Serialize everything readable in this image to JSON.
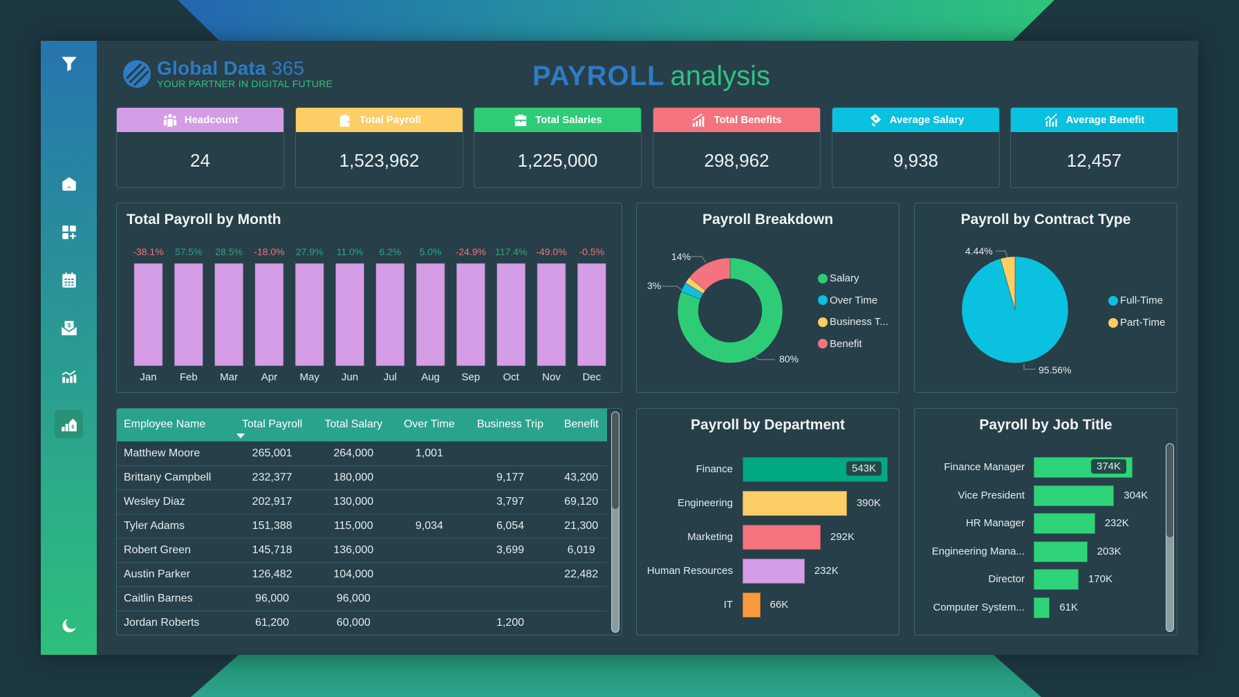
{
  "brand": {
    "name_bold": "Global Data",
    "name_light": "365",
    "tagline": "YOUR PARTNER IN DIGITAL FUTURE"
  },
  "page_title": {
    "part1": "PAYROLL",
    "part2": "analysis"
  },
  "sidebar": {
    "items": [
      {
        "name": "filter",
        "icon": "filter-icon"
      },
      {
        "name": "home",
        "icon": "home-icon"
      },
      {
        "name": "dashboard",
        "icon": "add-widget-icon"
      },
      {
        "name": "calendar",
        "icon": "calendar-icon"
      },
      {
        "name": "payslip",
        "icon": "money-envelope-icon"
      },
      {
        "name": "analytics",
        "icon": "bar-line-chart-icon"
      },
      {
        "name": "payroll",
        "icon": "dollar-growth-icon",
        "active": true
      },
      {
        "name": "theme",
        "icon": "moon-icon"
      }
    ]
  },
  "kpis": [
    {
      "label": "Headcount",
      "value": "24",
      "color": "#d59de6",
      "icon": "people-icon"
    },
    {
      "label": "Total Payroll",
      "value": "1,523,962",
      "color": "#fdcd66",
      "icon": "wallet-icon"
    },
    {
      "label": "Total Salaries",
      "value": "1,225,000",
      "color": "#2fcc78",
      "icon": "briefcase-icon"
    },
    {
      "label": "Total Benefits",
      "value": "298,962",
      "color": "#f4737e",
      "icon": "growth-chart-icon"
    },
    {
      "label": "Average Salary",
      "value": "9,938",
      "color": "#0bc1e0",
      "icon": "money-bill-icon"
    },
    {
      "label": "Average Benefit",
      "value": "12,457",
      "color": "#0bc1e0",
      "icon": "trend-chart-icon"
    }
  ],
  "chart_data": [
    {
      "id": "monthly",
      "type": "bar",
      "title": "Total Payroll by Month",
      "categories": [
        "Jan",
        "Feb",
        "Mar",
        "Apr",
        "May",
        "Jun",
        "Jul",
        "Aug",
        "Sep",
        "Oct",
        "Nov",
        "Dec"
      ],
      "values": [
        100,
        100,
        100,
        100,
        100,
        100,
        100,
        100,
        100,
        100,
        100,
        100
      ],
      "value_note": "bars shown at equal (100%) height",
      "labels": [
        "-38.1%",
        "57.5%",
        "28.5%",
        "-18.0%",
        "27.9%",
        "11.0%",
        "6.2%",
        "5.0%",
        "-24.9%",
        "117.4%",
        "-49.0%",
        "-0.5%"
      ],
      "bar_color": "#d59de6",
      "positive_color": "#2fa57e",
      "negative_color": "#f4737e",
      "xlabel": "",
      "ylabel": ""
    },
    {
      "id": "breakdown",
      "type": "pie",
      "donut": true,
      "title": "Payroll Breakdown",
      "categories": [
        "Salary",
        "Over Time",
        "Business T...",
        "Benefit"
      ],
      "values": [
        80,
        3,
        2,
        14
      ],
      "labels": [
        "80%",
        "3%",
        "",
        "14%"
      ],
      "colors": [
        "#2fcc78",
        "#0bc1e0",
        "#fdcd66",
        "#f4737e"
      ],
      "legend": "right"
    },
    {
      "id": "contract",
      "type": "pie",
      "title": "Payroll by Contract Type",
      "categories": [
        "Full-Time",
        "Part-Time"
      ],
      "values": [
        95.56,
        4.44
      ],
      "labels": [
        "95.56%",
        "4.44%"
      ],
      "colors": [
        "#0bc1e0",
        "#fdcd66"
      ],
      "legend": "right"
    },
    {
      "id": "department",
      "type": "bar",
      "orientation": "horizontal",
      "title": "Payroll by Department",
      "categories": [
        "Finance",
        "Engineering",
        "Marketing",
        "Human Resources",
        "IT"
      ],
      "values": [
        543,
        390,
        292,
        232,
        66
      ],
      "labels": [
        "543K",
        "390K",
        "292K",
        "232K",
        "66K"
      ],
      "colors": [
        "#01a882",
        "#fdcd66",
        "#f4737e",
        "#d59de6",
        "#fd9a3d"
      ],
      "unit": "K"
    },
    {
      "id": "jobtitle",
      "type": "bar",
      "orientation": "horizontal",
      "title": "Payroll by Job Title",
      "categories": [
        "Finance Manager",
        "Vice President",
        "HR Manager",
        "Engineering Mana...",
        "Director",
        "Computer System..."
      ],
      "values": [
        374,
        304,
        232,
        203,
        170,
        61
      ],
      "labels": [
        "374K",
        "304K",
        "232K",
        "203K",
        "170K",
        "61K"
      ],
      "colors": [
        "#2fd37a",
        "#2fd37a",
        "#2fd37a",
        "#2fd37a",
        "#2fd37a",
        "#2fd37a"
      ],
      "unit": "K"
    }
  ],
  "table": {
    "columns": [
      "Employee Name",
      "Total Payroll",
      "Total Salary",
      "Over Time",
      "Business Trip",
      "Benefit"
    ],
    "sorted_column": "Total Payroll",
    "rows": [
      [
        "Matthew Moore",
        "265,001",
        "264,000",
        "1,001",
        "",
        ""
      ],
      [
        "Brittany Campbell",
        "232,377",
        "180,000",
        "",
        "9,177",
        "43,200"
      ],
      [
        "Wesley Diaz",
        "202,917",
        "130,000",
        "",
        "3,797",
        "69,120"
      ],
      [
        "Tyler Adams",
        "151,388",
        "115,000",
        "9,034",
        "6,054",
        "21,300"
      ],
      [
        "Robert Green",
        "145,718",
        "136,000",
        "",
        "3,699",
        "6,019"
      ],
      [
        "Austin Parker",
        "126,482",
        "104,000",
        "",
        "",
        "22,482"
      ],
      [
        "Caitlin Barnes",
        "96,000",
        "96,000",
        "",
        "",
        ""
      ],
      [
        "Jordan Roberts",
        "61,200",
        "60,000",
        "",
        "1,200",
        ""
      ]
    ]
  }
}
